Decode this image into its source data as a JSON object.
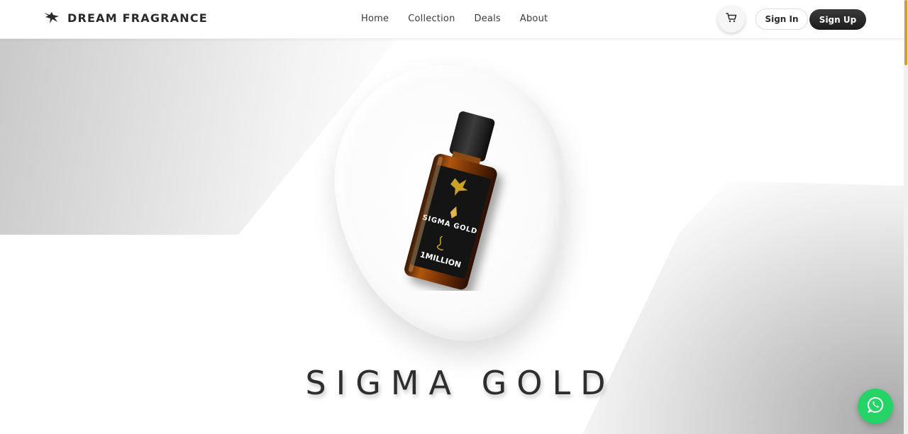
{
  "brand": {
    "name": "DREAM FRAGRANCE",
    "logo_icon": "eagle-logo-icon"
  },
  "nav": {
    "items": [
      {
        "label": "Home"
      },
      {
        "label": "Collection"
      },
      {
        "label": "Deals"
      },
      {
        "label": "About"
      }
    ]
  },
  "header_actions": {
    "cart_icon": "cart-icon",
    "sign_in_label": "Sign In",
    "sign_up_label": "Sign Up"
  },
  "hero": {
    "product_title": "SIGMA GOLD",
    "bottle_label": {
      "line1": "SIGMA GOLD",
      "line2": "1MILLION"
    }
  },
  "floating": {
    "whatsapp_icon": "whatsapp-icon"
  },
  "colors": {
    "accent_gold": "#c9a227",
    "whatsapp_green": "#25d366",
    "text_dark": "#2a2a2a"
  }
}
